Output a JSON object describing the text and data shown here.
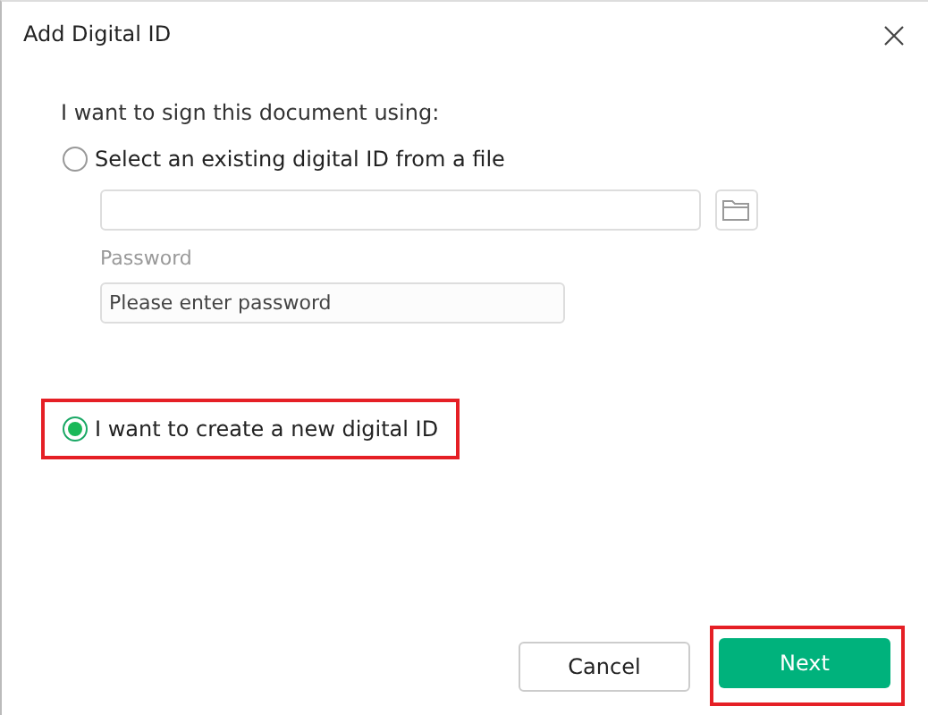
{
  "window": {
    "title": "Add Digital ID"
  },
  "prompt": "I want to sign this document using:",
  "options": [
    {
      "label": "Select an existing digital ID from a file",
      "kind": "file",
      "selected": false,
      "highlighted": false,
      "password": {
        "label": "Password",
        "placeholder": "Please enter password"
      }
    },
    {
      "label": "I want to create a new digital ID",
      "kind": "new",
      "selected": true,
      "highlighted": true
    }
  ],
  "buttons": [
    {
      "label": "Cancel",
      "kind": "secondary",
      "highlighted": false
    },
    {
      "label": "Next",
      "kind": "primary",
      "highlighted": true
    }
  ]
}
